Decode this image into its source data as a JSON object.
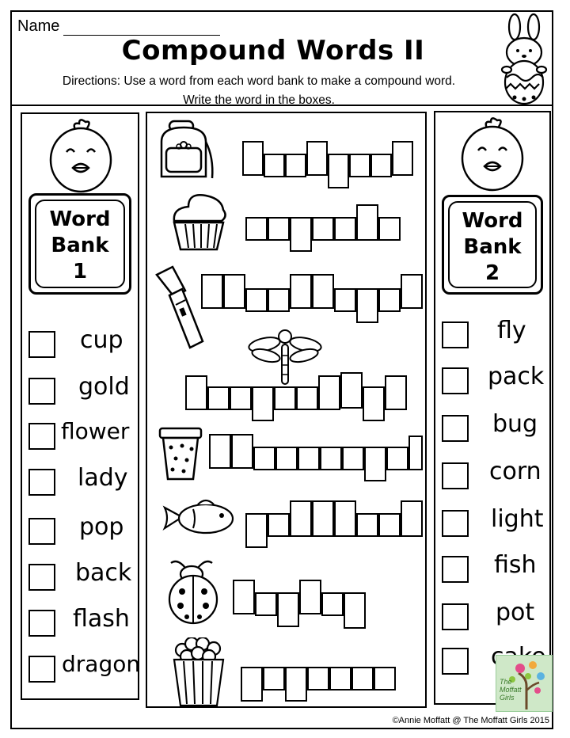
{
  "header": {
    "name_label": "Name",
    "title": "Compound Words II",
    "directions_line1": "Directions: Use a word from each word bank to make a compound word.",
    "directions_line2": "Write the word in the boxes."
  },
  "word_bank_1": {
    "heading_1": "Word",
    "heading_2": "Bank",
    "heading_3": "1",
    "words": [
      "cup",
      "gold",
      "flower",
      "lady",
      "pop",
      "back",
      "flash",
      "dragon"
    ]
  },
  "word_bank_2": {
    "heading_1": "Word",
    "heading_2": "Bank",
    "heading_3": "2",
    "words": [
      "fly",
      "pack",
      "bug",
      "corn",
      "light",
      "fish",
      "pot",
      "cake"
    ]
  },
  "pictures": [
    "backpack-icon",
    "cupcake-icon",
    "flashlight-icon",
    "dragonfly-icon",
    "flowerpot-icon",
    "goldfish-icon",
    "ladybug-icon",
    "popcorn-icon"
  ],
  "footer": {
    "copyright": "©Annie Moffatt @ The Moffatt Girls 2015",
    "logo_line1": "The",
    "logo_line2": "Moffatt",
    "logo_line3": "Girls"
  }
}
